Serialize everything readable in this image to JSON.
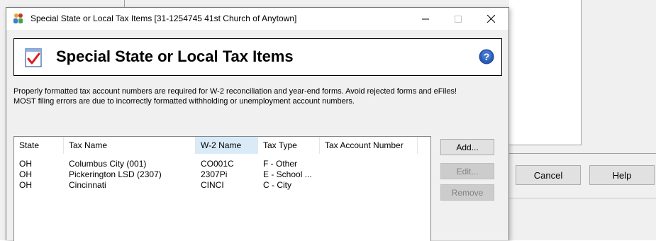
{
  "dialog": {
    "window_title": "Special State or Local Tax Items [31-1254745 41st Church of Anytown]",
    "header_title": "Special State or Local Tax Items",
    "info_line1": "Properly formatted tax account numbers are required for W-2 reconciliation and year-end forms. Avoid rejected forms and eFiles!",
    "info_line2": "MOST filing errors are due to incorrectly formatted withholding or unemployment account numbers.",
    "window_controls": {
      "minimize": "—",
      "maximize": "☐",
      "close": "✕"
    },
    "icons": {
      "app": "people-app-icon",
      "header": "checklist-icon",
      "help": "help-icon"
    },
    "accent_colors": {
      "check_red": "#d9201f",
      "help_blue": "#2a5db8"
    }
  },
  "grid": {
    "columns": [
      "State",
      "Tax Name",
      "W-2 Name",
      "Tax Type",
      "Tax Account Number"
    ],
    "sorted_column": "W-2 Name",
    "rows": [
      {
        "state": "OH",
        "tax_name": "Columbus City (001)",
        "w2_name": "CO001C",
        "tax_type": "F - Other",
        "account": ""
      },
      {
        "state": "OH",
        "tax_name": "Pickerington LSD (2307)",
        "w2_name": "2307Pi",
        "tax_type": "E - School ...",
        "account": ""
      },
      {
        "state": "OH",
        "tax_name": "Cincinnati",
        "w2_name": "CINCI",
        "tax_type": "C - City",
        "account": ""
      }
    ]
  },
  "buttons": {
    "add": "Add...",
    "edit": "Edit...",
    "remove": "Remove"
  },
  "background_window": {
    "cancel": "Cancel",
    "help": "Help"
  }
}
